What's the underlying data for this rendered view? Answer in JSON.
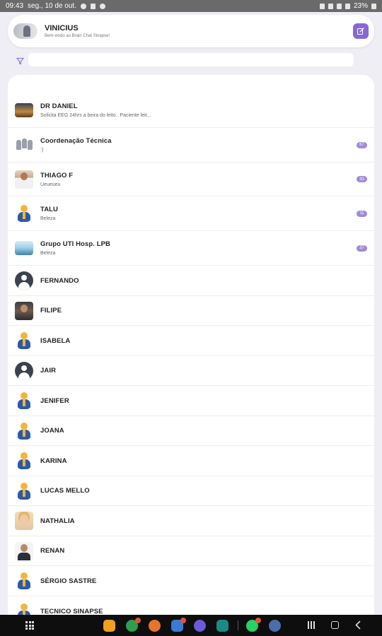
{
  "status_bar": {
    "time": "09:43",
    "date": "seg., 10 de out.",
    "battery": "23%"
  },
  "header": {
    "user_name": "VINICIUS",
    "welcome": "Bem-vindo ao Brain Chat Sinapse!",
    "compose_icon": "compose-icon"
  },
  "search": {
    "value": "",
    "placeholder": ""
  },
  "chats": [
    {
      "name": "DR DANIEL",
      "preview": "Solicita EEG 24hrs a beira do leito.. Paciente leit...",
      "badge": "",
      "avatar": "group-photo"
    },
    {
      "name": "Coordenação Técnica",
      "preview": ":)",
      "badge": "67",
      "avatar": "trio"
    },
    {
      "name": "THIAGO F",
      "preview": "Ueueueu",
      "badge": "33",
      "avatar": "man"
    },
    {
      "name": "TALU",
      "preview": "Beleza",
      "badge": "11",
      "avatar": "gold"
    },
    {
      "name": "Grupo UTI Hosp. LPB",
      "preview": "Beleza",
      "badge": "37",
      "avatar": "group-img"
    },
    {
      "name": "FERNANDO",
      "preview": "",
      "badge": "",
      "avatar": "default"
    },
    {
      "name": "FILIPE",
      "preview": "",
      "badge": "",
      "avatar": "photo-dark"
    },
    {
      "name": "ISABELA",
      "preview": "",
      "badge": "",
      "avatar": "gold"
    },
    {
      "name": "JAIR",
      "preview": "",
      "badge": "",
      "avatar": "default"
    },
    {
      "name": "JENIFER",
      "preview": "",
      "badge": "",
      "avatar": "gold"
    },
    {
      "name": "JOANA",
      "preview": "",
      "badge": "",
      "avatar": "gold"
    },
    {
      "name": "KARINA",
      "preview": "",
      "badge": "",
      "avatar": "gold"
    },
    {
      "name": "LUCAS MELLO",
      "preview": "",
      "badge": "",
      "avatar": "gold"
    },
    {
      "name": "NATHALIA",
      "preview": "",
      "badge": "",
      "avatar": "blonde"
    },
    {
      "name": "RENAN",
      "preview": "",
      "badge": "",
      "avatar": "suit"
    },
    {
      "name": "SÉRGIO SASTRE",
      "preview": "",
      "badge": "",
      "avatar": "gold"
    },
    {
      "name": "TECNICO SINAPSE",
      "preview": "",
      "badge": "",
      "avatar": "gold"
    }
  ],
  "dock": {
    "apps": [
      {
        "name": "files-app-icon",
        "color": "#f0a020"
      },
      {
        "name": "phone-app-icon",
        "color": "#2e9e4f"
      },
      {
        "name": "contacts-app-icon",
        "color": "#e8742c"
      },
      {
        "name": "messages-app-icon",
        "color": "#3a7bd5"
      },
      {
        "name": "browser-app-icon",
        "color": "#6b5bd6"
      },
      {
        "name": "calendar-app-icon",
        "color": "#1b8a86"
      },
      {
        "name": "whatsapp-app-icon",
        "color": "#25d366"
      },
      {
        "name": "settings-app-icon",
        "color": "#4a6fa8"
      }
    ]
  },
  "colors": {
    "accent": "#8a67d6",
    "badge": "#a18ad9",
    "background": "#eeeef4"
  }
}
